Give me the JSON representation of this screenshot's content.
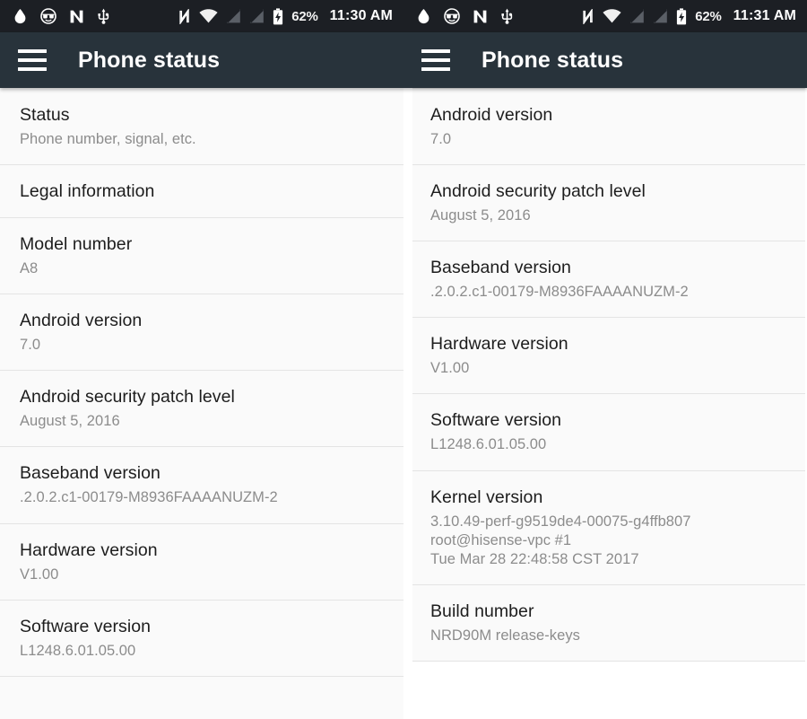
{
  "panels": [
    {
      "statusbar": {
        "left_icons": [
          "flame-icon",
          "sunglasses-face-icon",
          "nfc-n-logo-icon",
          "usb-icon"
        ],
        "right_icons": [
          "nfc-icon",
          "wifi-icon",
          "signal-empty-sim1-icon",
          "signal-empty-sim2-icon",
          "battery-charging-icon"
        ],
        "battery_percent": "62%",
        "clock": "11:30 AM"
      },
      "appbar": {
        "menu_icon": "hamburger-menu-icon",
        "title": "Phone status"
      },
      "rows": [
        {
          "title": "Status",
          "summary": "Phone number, signal, etc."
        },
        {
          "title": "Legal information",
          "summary": ""
        },
        {
          "title": "Model number",
          "summary": "A8"
        },
        {
          "title": "Android version",
          "summary": "7.0"
        },
        {
          "title": "Android security patch level",
          "summary": "August 5, 2016"
        },
        {
          "title": "Baseband version",
          "summary": ".2.0.2.c1-00179-M8936FAAAANUZM-2"
        },
        {
          "title": "Hardware version",
          "summary": "V1.00"
        },
        {
          "title": "Software version",
          "summary": "L1248.6.01.05.00"
        }
      ]
    },
    {
      "statusbar": {
        "left_icons": [
          "flame-icon",
          "sunglasses-face-icon",
          "nfc-n-logo-icon",
          "usb-icon"
        ],
        "right_icons": [
          "nfc-icon",
          "wifi-icon",
          "signal-empty-sim1-icon",
          "signal-empty-sim2-icon",
          "battery-charging-icon"
        ],
        "battery_percent": "62%",
        "clock": "11:31 AM"
      },
      "appbar": {
        "menu_icon": "hamburger-menu-icon",
        "title": "Phone status"
      },
      "rows": [
        {
          "title": "Android version",
          "summary": "7.0"
        },
        {
          "title": "Android security patch level",
          "summary": "August 5, 2016"
        },
        {
          "title": "Baseband version",
          "summary": ".2.0.2.c1-00179-M8936FAAAANUZM-2"
        },
        {
          "title": "Hardware version",
          "summary": "V1.00"
        },
        {
          "title": "Software version",
          "summary": "L1248.6.01.05.00"
        },
        {
          "title": "Kernel version",
          "summary": "3.10.49-perf-g9519de4-00075-g4ffb807\nroot@hisense-vpc #1\nTue Mar 28 22:48:58 CST 2017"
        },
        {
          "title": "Build number",
          "summary": "NRD90M release-keys"
        }
      ]
    }
  ],
  "colors": {
    "statusbar_bg": "#1c1f24",
    "appbar_bg": "#28333b",
    "list_bg": "#fafafa",
    "divider": "#e4e4e4",
    "title_text": "#1d1d1d",
    "summary_text": "#8c8c8c"
  }
}
